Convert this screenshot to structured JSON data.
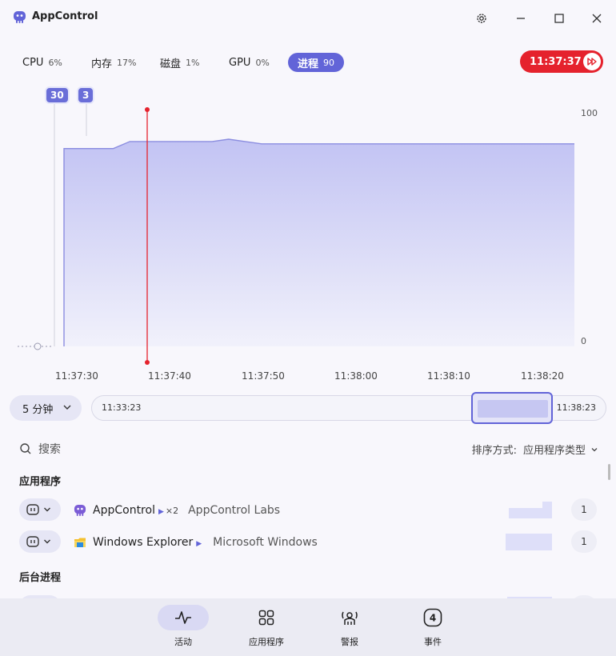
{
  "app": {
    "title": "AppControl"
  },
  "metrics": [
    {
      "label": "CPU",
      "value": "6%"
    },
    {
      "label": "内存",
      "value": "17%"
    },
    {
      "label": "磁盘",
      "value": "1%"
    },
    {
      "label": "GPU",
      "value": "0%"
    },
    {
      "label": "进程",
      "value": "90"
    }
  ],
  "clock": "11:37:37",
  "chart_data": {
    "type": "area",
    "title": "",
    "xlabel": "",
    "ylabel": "",
    "x_ticks": [
      "11:37:30",
      "11:37:40",
      "11:37:50",
      "11:38:00",
      "11:38:10",
      "11:38:20"
    ],
    "y_ticks": [
      "100",
      "0"
    ],
    "markers": [
      "30",
      "3"
    ],
    "cursor_time": "11:37:37",
    "grid": false,
    "series": [
      {
        "values": [
          85,
          85,
          85,
          85,
          88,
          88,
          88,
          88,
          88,
          88,
          89,
          88,
          87,
          87,
          87,
          87,
          87,
          87,
          87,
          87,
          87,
          87,
          87,
          87,
          87,
          87,
          87,
          87,
          87,
          87,
          87,
          87
        ]
      }
    ]
  },
  "range": {
    "label": "5 分钟",
    "start": "11:33:23",
    "end": "11:38:23"
  },
  "search": {
    "placeholder": "搜索"
  },
  "sort": {
    "label": "排序方式:",
    "value": "应用程序类型"
  },
  "sections": {
    "apps_title": "应用程序",
    "background_title": "后台进程"
  },
  "apps": [
    {
      "name": "AppControl",
      "multiplier": "×2",
      "publisher": "AppControl Labs",
      "count": "1"
    },
    {
      "name": "Windows Explorer",
      "multiplier": "",
      "publisher": "Microsoft Windows",
      "count": "1"
    }
  ],
  "nav": [
    {
      "label": "活动"
    },
    {
      "label": "应用程序"
    },
    {
      "label": "警报"
    },
    {
      "label": "事件",
      "badge": "4"
    }
  ],
  "colors": {
    "accent": "#6264d8",
    "alert": "#e5222d",
    "area_fill": "#c9caf5"
  }
}
